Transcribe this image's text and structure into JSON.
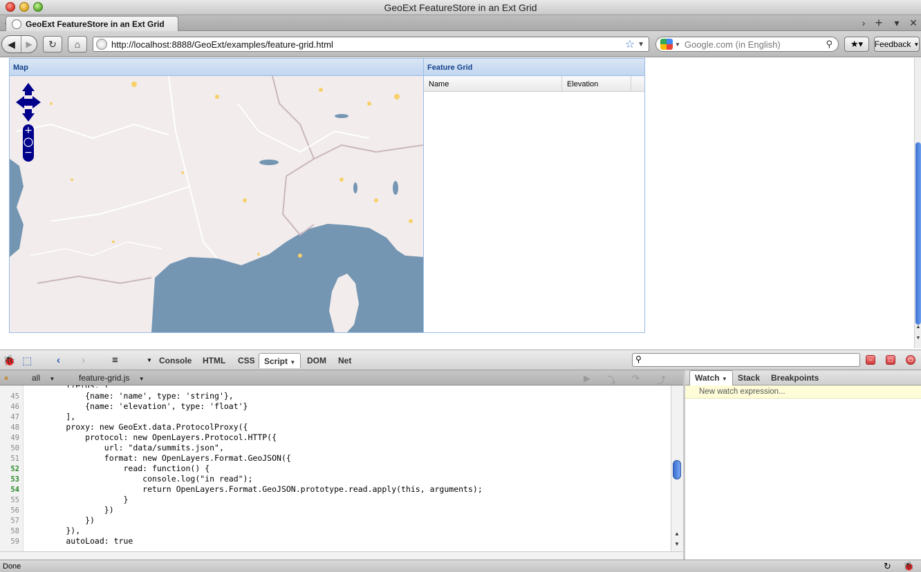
{
  "window": {
    "title": "GeoExt FeatureStore in an Ext Grid"
  },
  "tab": {
    "label": "GeoExt FeatureStore in an Ext Grid"
  },
  "nav": {
    "url": "http://localhost:8888/GeoExt/examples/feature-grid.html",
    "search_placeholder": "Google.com (in English)",
    "feedback_label": "Feedback"
  },
  "map_panel": {
    "title": "Map"
  },
  "grid_panel": {
    "title": "Feature Grid",
    "columns": [
      "Name",
      "Elevation"
    ]
  },
  "firebug": {
    "tabs": [
      "Console",
      "HTML",
      "CSS",
      "Script",
      "DOM",
      "Net"
    ],
    "active_tab": "Script",
    "filter": "all",
    "file": "feature-grid.js",
    "side_tabs": [
      "Watch",
      "Stack",
      "Breakpoints"
    ],
    "watch_placeholder": "New watch expression...",
    "code": [
      {
        "n": "45",
        "t": "            {name: 'name', type: 'string'},"
      },
      {
        "n": "46",
        "t": "            {name: 'elevation', type: 'float'}"
      },
      {
        "n": "47",
        "t": "        ],"
      },
      {
        "n": "48",
        "t": "        proxy: new GeoExt.data.ProtocolProxy({"
      },
      {
        "n": "49",
        "t": "            protocol: new OpenLayers.Protocol.HTTP({"
      },
      {
        "n": "50",
        "t": "                url: \"data/summits.json\","
      },
      {
        "n": "51",
        "t": "                format: new OpenLayers.Format.GeoJSON({"
      },
      {
        "n": "52",
        "t": "                    read: function() {",
        "exec": true
      },
      {
        "n": "53",
        "t": "                        console.log(\"in read\");",
        "exec": true
      },
      {
        "n": "54",
        "t": "                        return OpenLayers.Format.GeoJSON.prototype.read.apply(this, arguments);",
        "exec": true
      },
      {
        "n": "55",
        "t": "                    }"
      },
      {
        "n": "56",
        "t": "                })"
      },
      {
        "n": "57",
        "t": "            })"
      },
      {
        "n": "58",
        "t": "        }),"
      },
      {
        "n": "59",
        "t": "        autoLoad: true"
      }
    ]
  },
  "status": {
    "text": "Done"
  },
  "colors": {
    "sea": "#7496b3",
    "land": "#f2ecec",
    "panel_border": "#99bbe8",
    "panel_header_text": "#15428b"
  }
}
